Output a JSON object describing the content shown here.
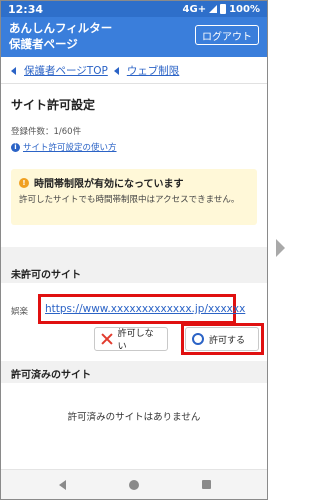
{
  "status_bar": {
    "time": "12:34",
    "network": "4G+",
    "battery": "100%"
  },
  "app_bar": {
    "title_line1": "あんしんフィルター",
    "title_line2": "保護者ページ",
    "logout_label": "ログアウト"
  },
  "breadcrumbs": [
    {
      "label": "保護者ページTOP"
    },
    {
      "label": "ウェブ制限"
    }
  ],
  "page": {
    "title": "サイト許可設定",
    "registered_count": "登録件数：1/60件",
    "help_link": "サイト許可設定の使い方"
  },
  "notice": {
    "title": "時間帯制限が有効になっています",
    "body": "許可したサイトでも時間帯制限中はアクセスできません。"
  },
  "unpermitted": {
    "heading": "未許可のサイト",
    "item": {
      "category": "娯楽",
      "url": "https://www.xxxxxxxxxxxxx.jp/xxxxxx",
      "deny_label": "許可しない",
      "allow_label": "許可する"
    }
  },
  "permitted": {
    "heading": "許可済みのサイト",
    "empty_message": "許可済みのサイトはありません"
  },
  "colors": {
    "primary": "#3a7edb",
    "link": "#2b63c6",
    "highlight": "#e01010",
    "notice_bg": "#fff8d8",
    "warning": "#f0a020"
  },
  "icons": {
    "warning": "warning-icon",
    "info": "info-icon",
    "deny": "x-icon",
    "allow": "circle-icon"
  }
}
